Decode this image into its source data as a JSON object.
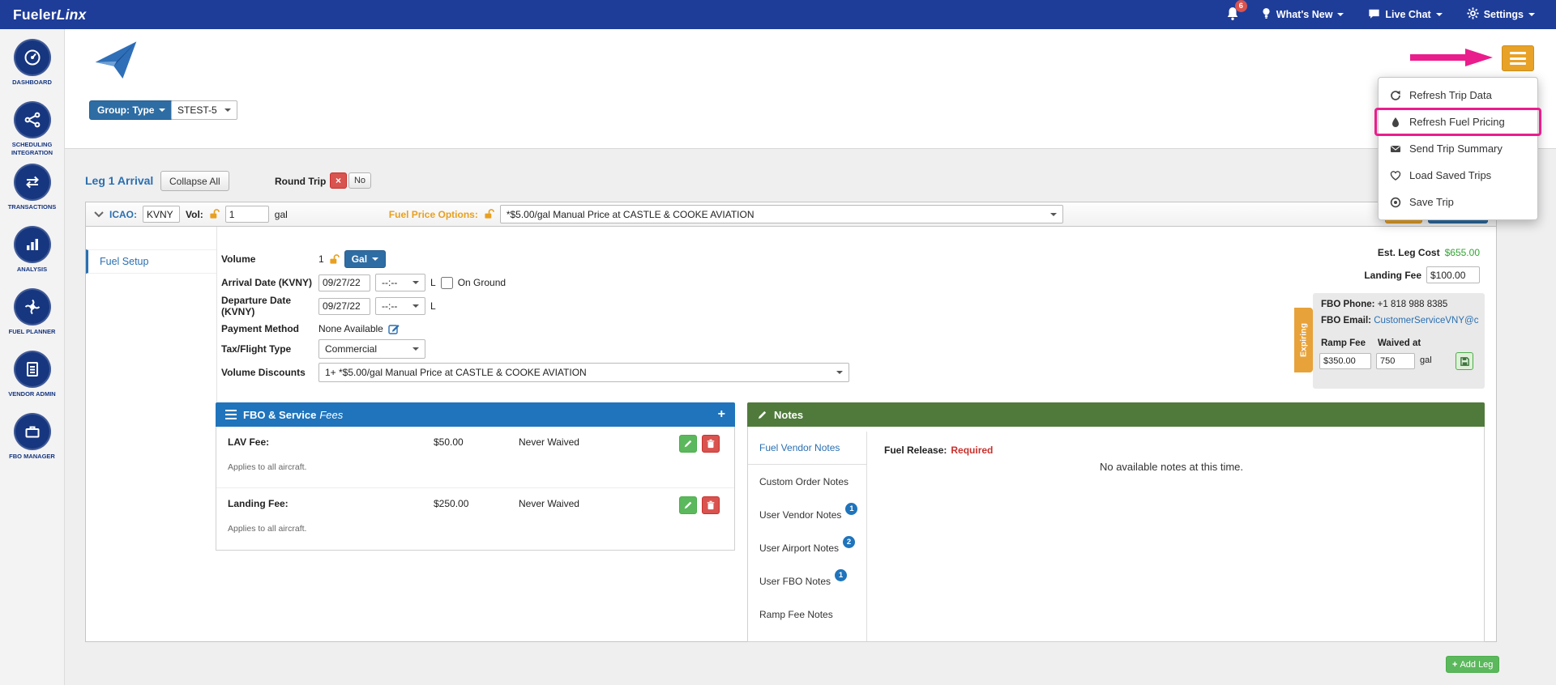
{
  "topbar": {
    "brand_bold": "Fueler",
    "brand_italic": "Linx",
    "notification_count": "6",
    "whats_new_label": "What's New",
    "live_chat_label": "Live Chat",
    "settings_label": "Settings"
  },
  "sidebar": {
    "items": [
      {
        "label": "DASHBOARD",
        "icon": "gauge-icon"
      },
      {
        "label": "SCHEDULING INTEGRATION",
        "icon": "share-nodes-icon"
      },
      {
        "label": "TRANSACTIONS",
        "icon": "swap-arrows-icon"
      },
      {
        "label": "ANALYSIS",
        "icon": "bar-chart-icon"
      },
      {
        "label": "FUEL PLANNER",
        "icon": "turbine-icon"
      },
      {
        "label": "VENDOR ADMIN",
        "icon": "document-icon"
      },
      {
        "label": "FBO MANAGER",
        "icon": "briefcase-icon"
      }
    ]
  },
  "toolbar": {
    "group_type_label": "Group: Type",
    "aircraft_value": "STEST-5"
  },
  "actions_menu": {
    "items": [
      {
        "label": "Refresh Trip Data",
        "icon": "refresh-icon"
      },
      {
        "label": "Refresh Fuel Pricing",
        "icon": "fuel-drop-icon",
        "highlighted": true
      },
      {
        "label": "Send Trip Summary",
        "icon": "envelope-icon"
      },
      {
        "label": "Load Saved Trips",
        "icon": "heart-icon"
      },
      {
        "label": "Save Trip",
        "icon": "save-circle-icon"
      }
    ]
  },
  "leg_header": {
    "title": "Leg 1 Arrival",
    "collapse_all_label": "Collapse All",
    "round_trip_label": "Round Trip",
    "round_trip_x": "×",
    "round_trip_no": "No"
  },
  "leg_bar": {
    "icao_label": "ICAO:",
    "icao_value": "KVNY",
    "vol_label": "Vol:",
    "vol_value": "1",
    "vol_unit": "gal",
    "fuel_price_label": "Fuel Price Options:",
    "fuel_price_value": "*$5.00/gal Manual Price at CASTLE & COOKE AVIATION"
  },
  "fuel_setup": {
    "tab_label": "Fuel Setup",
    "volume_label": "Volume",
    "volume_value": "1",
    "volume_unit_label": "Gal",
    "arrival_label": "Arrival Date (KVNY)",
    "arrival_date": "09/27/22",
    "arrival_time": "--:--",
    "departure_label": "Departure Date (KVNY)",
    "departure_date": "09/27/22",
    "departure_time": "--:--",
    "local_suffix": "L",
    "on_ground_label": "On Ground",
    "payment_label": "Payment Method",
    "payment_value": "None Available",
    "tax_label": "Tax/Flight Type",
    "tax_value": "Commercial",
    "discounts_label": "Volume Discounts",
    "discounts_value": "1+ *$5.00/gal Manual Price at CASTLE & COOKE AVIATION"
  },
  "cost": {
    "est_leg_cost_label": "Est. Leg Cost",
    "est_leg_cost_value": "$655.00",
    "landing_fee_label": "Landing Fee",
    "landing_fee_value": "$100.00"
  },
  "fbo_info": {
    "expiring_label": "Expiring",
    "phone_label": "FBO Phone:",
    "phone_value": "+1 818 988 8385",
    "email_label": "FBO Email:",
    "email_value": "CustomerServiceVNY@c",
    "ramp_fee_label": "Ramp Fee",
    "waived_at_label": "Waived at",
    "ramp_fee_value": "$350.00",
    "waived_at_value": "750",
    "waived_at_unit": "gal"
  },
  "fees_panel": {
    "title_main": "FBO & Service",
    "title_italic": "Fees",
    "add_label": "+",
    "rows": [
      {
        "name": "LAV Fee:",
        "amount": "$50.00",
        "waived": "Never Waived",
        "applies": "Applies to all aircraft."
      },
      {
        "name": "Landing Fee:",
        "amount": "$250.00",
        "waived": "Never Waived",
        "applies": "Applies to all aircraft."
      }
    ]
  },
  "notes_panel": {
    "title": "Notes",
    "tabs": [
      {
        "label": "Fuel Vendor Notes",
        "active": true
      },
      {
        "label": "Custom Order Notes"
      },
      {
        "label": "User Vendor Notes",
        "badge": "1"
      },
      {
        "label": "User Airport Notes",
        "badge": "2"
      },
      {
        "label": "User FBO Notes",
        "badge": "1"
      },
      {
        "label": "Ramp Fee Notes"
      }
    ],
    "fuel_release_label": "Fuel Release:",
    "fuel_release_value": "Required",
    "empty_text": "No available notes at this time."
  },
  "footer": {
    "add_leg_plus": "+",
    "add_leg_label": "Add Leg"
  },
  "colors": {
    "topbar_blue": "#1e3d99",
    "primary_blue": "#2e6da4",
    "link_blue": "#2a6fb0",
    "fees_header_blue": "#1f74bc",
    "notes_header_green": "#507a3c",
    "success_green": "#5cb85c",
    "est_cost_green": "#33a433",
    "amber": "#e8a227",
    "annotation_pink": "#ea1d8d",
    "required_red": "#c9302c"
  },
  "annotations": {
    "arrow_icon": "annotation-arrow",
    "highlighted_menu_item": "Refresh Fuel Pricing"
  }
}
